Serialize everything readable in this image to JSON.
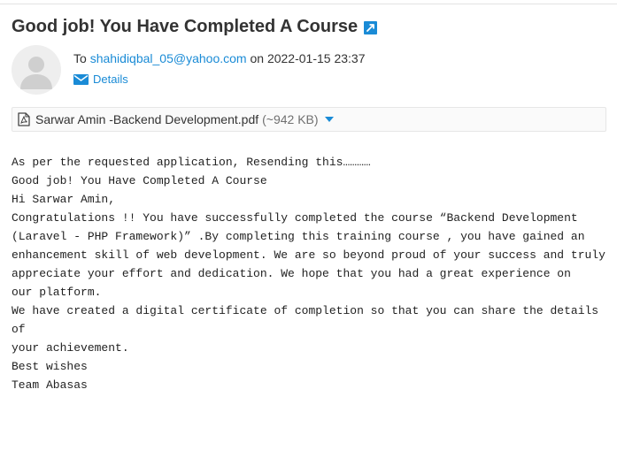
{
  "message": {
    "subject": "Good job! You Have Completed A Course",
    "to_label": "To",
    "recipient": "shahidiqbal_05@yahoo.com",
    "on_label": "on",
    "datetime": "2022-01-15 23:37",
    "details_label": "Details"
  },
  "attachment": {
    "filename": "Sarwar Amin -Backend Development.pdf",
    "size": "(~942 KB)"
  },
  "body_lines": [
    "As per the requested application, Resending this…………",
    "Good job! You Have Completed A Course",
    "Hi Sarwar Amin,",
    "Congratulations !! You have successfully completed the course “Backend Development (Laravel - PHP Framework)” .By completing this training course , you have gained an enhancement skill of web development. We are so beyond proud of your success and truly appreciate your effort and dedication. We hope that you had a great experience on",
    "our platform.",
    "We have created a digital certificate of completion so that you can share the details of",
    "your achievement.",
    "Best wishes",
    "Team Abasas"
  ],
  "colors": {
    "link": "#1a8bd6",
    "text": "#333333",
    "avatar_bg": "#eeeeee",
    "avatar_fg": "#cfcfcf"
  }
}
